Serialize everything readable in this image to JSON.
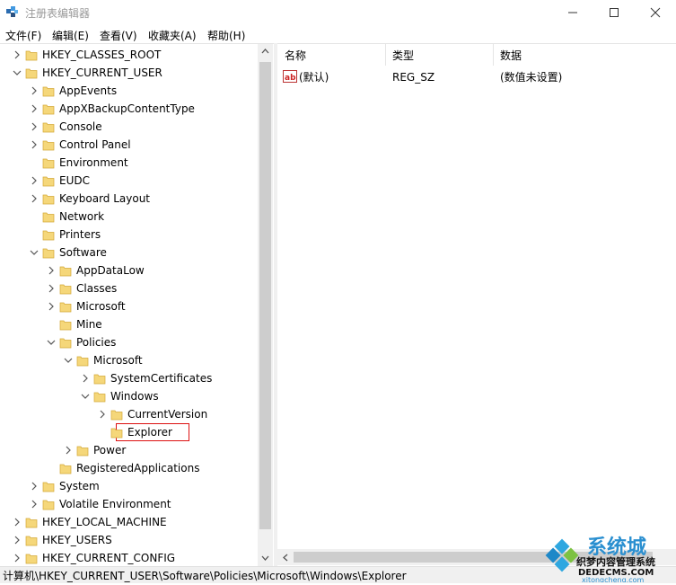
{
  "window": {
    "title": "注册表编辑器",
    "icon": "registry-icon",
    "buttons": [
      "minimize-icon",
      "maximize-icon",
      "close-icon"
    ]
  },
  "menubar": {
    "items": [
      "文件(F)",
      "编辑(E)",
      "查看(V)",
      "收藏夹(A)",
      "帮助(H)"
    ]
  },
  "tree": {
    "items": [
      {
        "label": "HKEY_CLASSES_ROOT",
        "expanded": false
      },
      {
        "label": "HKEY_CURRENT_USER",
        "expanded": true
      },
      {
        "label": "AppEvents",
        "expanded": false
      },
      {
        "label": "AppXBackupContentType",
        "expanded": false
      },
      {
        "label": "Console",
        "expanded": false
      },
      {
        "label": "Control Panel",
        "expanded": false
      },
      {
        "label": "Environment",
        "expanded": false
      },
      {
        "label": "EUDC",
        "expanded": false
      },
      {
        "label": "Keyboard Layout",
        "expanded": false
      },
      {
        "label": "Network",
        "expanded": false
      },
      {
        "label": "Printers",
        "expanded": false
      },
      {
        "label": "Software",
        "expanded": true
      },
      {
        "label": "AppDataLow",
        "expanded": false
      },
      {
        "label": "Classes",
        "expanded": false
      },
      {
        "label": "Microsoft",
        "expanded": false
      },
      {
        "label": "Mine",
        "expanded": false
      },
      {
        "label": "Policies",
        "expanded": true
      },
      {
        "label": "Microsoft",
        "expanded": true
      },
      {
        "label": "SystemCertificates",
        "expanded": false
      },
      {
        "label": "Windows",
        "expanded": true
      },
      {
        "label": "CurrentVersion",
        "expanded": false
      },
      {
        "label": "Explorer",
        "expanded": false,
        "selected": true
      },
      {
        "label": "Power",
        "expanded": false
      },
      {
        "label": "RegisteredApplications",
        "expanded": false
      },
      {
        "label": "System",
        "expanded": false
      },
      {
        "label": "Volatile Environment",
        "expanded": false
      },
      {
        "label": "HKEY_LOCAL_MACHINE",
        "expanded": false
      },
      {
        "label": "HKEY_USERS",
        "expanded": false
      },
      {
        "label": "HKEY_CURRENT_CONFIG",
        "expanded": false
      }
    ]
  },
  "list": {
    "columns": [
      "名称",
      "类型",
      "数据"
    ],
    "rows": [
      {
        "icon": "string-value-icon",
        "name": "(默认)",
        "type": "REG_SZ",
        "data": "(数值未设置)"
      }
    ]
  },
  "statusbar": {
    "path": "计算机\\HKEY_CURRENT_USER\\Software\\Policies\\Microsoft\\Windows\\Explorer"
  },
  "watermark": {
    "text": "系统城 xitongcheng.com 织梦内容管理系统 DEDECMS.COM"
  },
  "colors": {
    "folder": "#f5d77a",
    "selection_border": "#d11111",
    "chrome": "#f0f0f0"
  }
}
